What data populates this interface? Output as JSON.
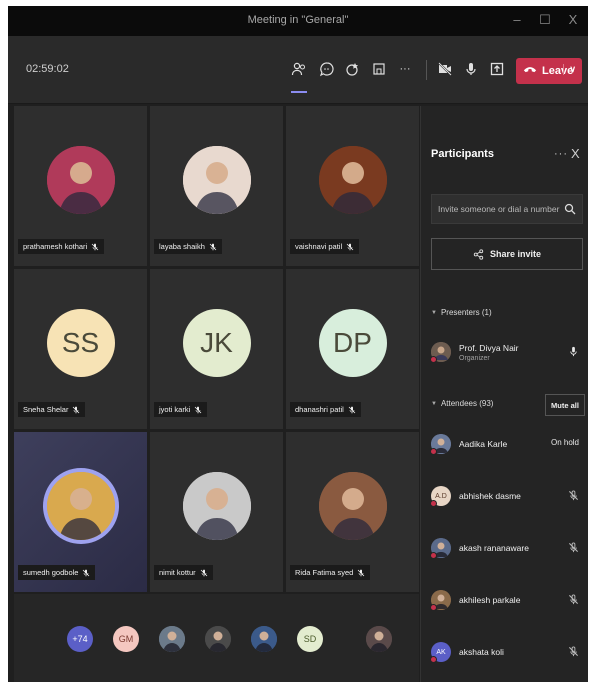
{
  "window": {
    "title": "Meeting in \"General\"",
    "controls": [
      "–",
      "☐",
      "X"
    ]
  },
  "topbar": {
    "timer": "02:59:02",
    "icons": [
      "people-icon",
      "chat-icon",
      "reactions-icon",
      "rooms-icon",
      "more-icon",
      "camera-off-icon",
      "mic-icon",
      "share-icon"
    ],
    "more_label": "···",
    "leave_label": "Leave",
    "leave_chevron": "∨",
    "accent": "#c4314b"
  },
  "grid": {
    "tiles": [
      {
        "name": "prathamesh kothari",
        "type": "photo",
        "bg": "#b03a5a"
      },
      {
        "name": "layaba shaikh",
        "type": "photo",
        "bg": "#e8d9cf"
      },
      {
        "name": "vaishnavi patil",
        "type": "photo",
        "bg": "#7a3a20"
      },
      {
        "name": "Sneha Shelar",
        "type": "initials",
        "initials": "SS",
        "bg": "#f7e3b5"
      },
      {
        "name": "jyoti karki",
        "type": "initials",
        "initials": "JK",
        "bg": "#e3eccf"
      },
      {
        "name": "dhanashri patil",
        "type": "initials",
        "initials": "DP",
        "bg": "#d8eedc"
      },
      {
        "name": "sumedh godbole",
        "type": "photo",
        "bg": "#d9a94e",
        "speaking": true
      },
      {
        "name": "nimit kottur",
        "type": "photo",
        "bg": "#c9c9c9"
      },
      {
        "name": "Rida Fatima syed",
        "type": "photo",
        "bg": "#8a5a40"
      }
    ]
  },
  "strip": {
    "items": [
      {
        "label": "+74",
        "bg": "#5b5fc7",
        "color": "#ffffff"
      },
      {
        "label": "GM",
        "bg": "#f4c7c0",
        "color": "#7a3a30"
      },
      {
        "label": "",
        "bg": "#6b7a8a",
        "color": "#ffffff"
      },
      {
        "label": "",
        "bg": "#4a4a4a",
        "color": "#ffffff"
      },
      {
        "label": "",
        "bg": "#3b5a8a",
        "color": "#ffffff"
      },
      {
        "label": "SD",
        "bg": "#e3eccf",
        "color": "#4a5a2a"
      },
      {
        "label": "",
        "bg": "#5a4a4a",
        "color": "#ffffff"
      }
    ]
  },
  "panel": {
    "title": "Participants",
    "more": "···",
    "close": "X",
    "invite_placeholder": "Invite someone or dial a number",
    "share_label": "Share invite",
    "presenters_label": "Presenters (1)",
    "attendees_label": "Attendees (93)",
    "mute_all_label": "Mute all",
    "presenters": [
      {
        "name": "Prof. Divya Nair",
        "sub": "Organizer",
        "right": "mic"
      }
    ],
    "attendees": [
      {
        "name": "Aadika Karle",
        "right": "On hold",
        "bg": "#6a7a9a",
        "initials": ""
      },
      {
        "name": "abhishek dasme",
        "right": "mic-off",
        "bg": "#e8d6c6",
        "initials": "A.D"
      },
      {
        "name": "akash rananaware",
        "right": "mic-off",
        "bg": "#5a6a8a",
        "initials": ""
      },
      {
        "name": "akhilesh parkale",
        "right": "mic-off",
        "bg": "#8a6a4a",
        "initials": ""
      },
      {
        "name": "akshata koli",
        "right": "mic-off",
        "bg": "#5b5fc7",
        "initials": "AK"
      }
    ]
  }
}
